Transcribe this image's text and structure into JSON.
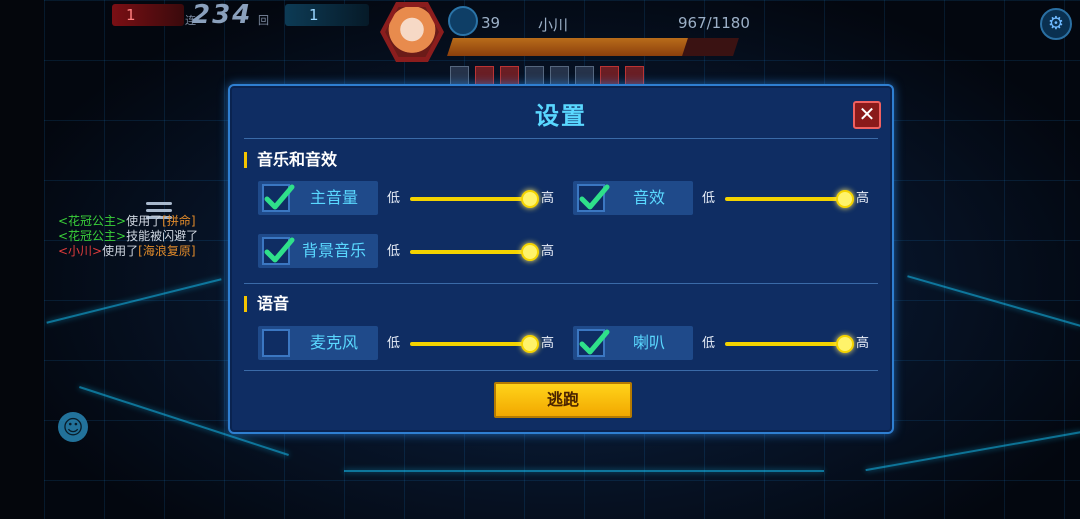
{
  "hud": {
    "team_red_score": "1",
    "kill_count": "234",
    "kill_prefix": "连",
    "kill_suffix": "回",
    "team_blue_score": "1",
    "level": "39",
    "player_name": "小川",
    "hp_text": "967/1180",
    "hp_fraction": 0.82
  },
  "chat": {
    "lines": [
      {
        "name": "<花冠公主>",
        "text": "使用了",
        "item": "[拼命]"
      },
      {
        "name": "<花冠公主>",
        "text": "技能被闪避了",
        "item": ""
      },
      {
        "name": "<小川>",
        "text": "使用了",
        "item": "[海浪复原]"
      }
    ]
  },
  "dialog": {
    "title": "设置",
    "sections": {
      "audio": {
        "title": "音乐和音效",
        "master_volume": {
          "label": "主音量",
          "checked": true,
          "level": 1.0
        },
        "sound_effects": {
          "label": "音效",
          "checked": true,
          "level": 1.0
        },
        "bgm": {
          "label": "背景音乐",
          "checked": true,
          "level": 1.0
        }
      },
      "voice": {
        "title": "语音",
        "microphone": {
          "label": "麦克风",
          "checked": false,
          "level": 1.0
        },
        "speaker": {
          "label": "喇叭",
          "checked": true,
          "level": 1.0
        }
      }
    },
    "low_label": "低",
    "high_label": "高",
    "escape_button": "逃跑"
  },
  "colors": {
    "accent_cyan": "#5ad8ff",
    "check_green": "#2fe08a",
    "slider_yellow": "#f4d300",
    "button_yellow": "#ffd31a"
  }
}
